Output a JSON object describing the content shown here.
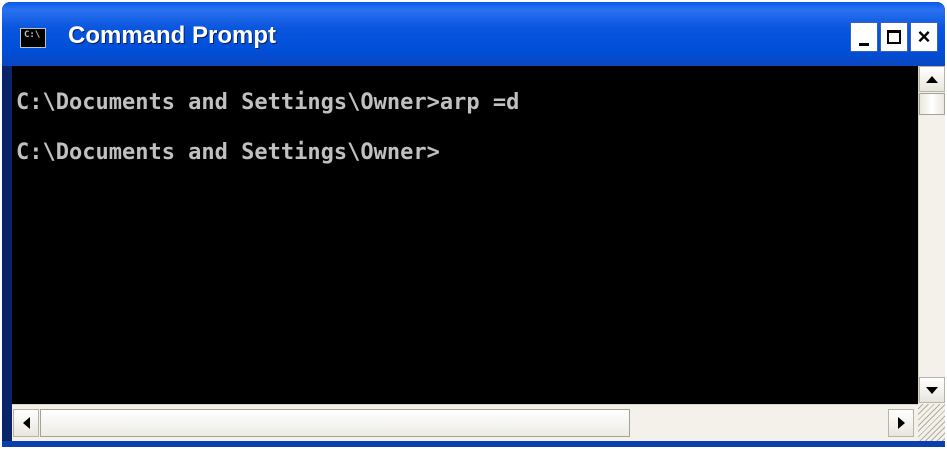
{
  "window": {
    "title": "Command Prompt",
    "icon_text": "C:\\",
    "controls": {
      "minimize": "minimize-icon",
      "maximize": "maximize-icon",
      "close": "×"
    }
  },
  "console": {
    "lines": [
      "C:\\Documents and Settings\\Owner>arp =d",
      "C:\\Documents and Settings\\Owner>"
    ]
  },
  "colors": {
    "titlebar_blue": "#0a56de",
    "console_bg": "#000000",
    "console_text": "#c0c0c0"
  }
}
